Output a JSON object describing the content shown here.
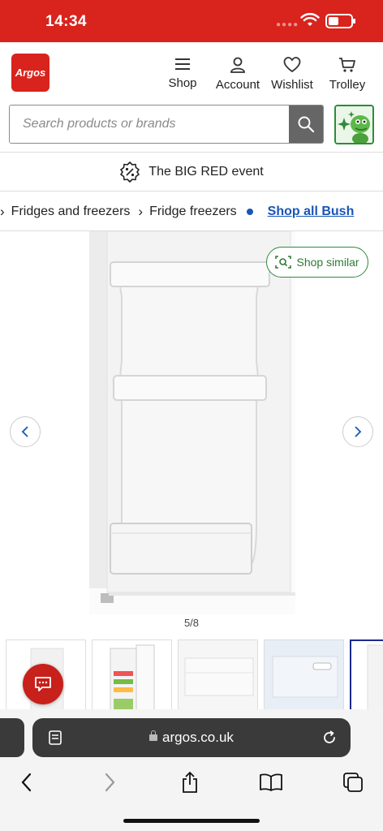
{
  "status_bar": {
    "time": "14:34",
    "battery_level": 0.45,
    "background": "#d9231d"
  },
  "header": {
    "logo_text": "Argos",
    "nav": {
      "shop": "Shop",
      "account": "Account",
      "wishlist": "Wishlist",
      "trolley": "Trolley"
    },
    "search": {
      "placeholder": "Search products or brands",
      "value": ""
    }
  },
  "event_banner": {
    "text": "The BIG RED event"
  },
  "breadcrumb": {
    "items": [
      "Fridges and freezers",
      "Fridge freezers"
    ],
    "shop_all_link": "Shop all Bush"
  },
  "gallery": {
    "shop_similar_label": "Shop similar",
    "counter": "5/8",
    "current_index": 5,
    "total": 8
  },
  "browser": {
    "url": "argos.co.uk"
  },
  "colors": {
    "brand_red": "#d9231d",
    "link_blue": "#1a55b7",
    "green_accent": "#2e8b3a"
  }
}
